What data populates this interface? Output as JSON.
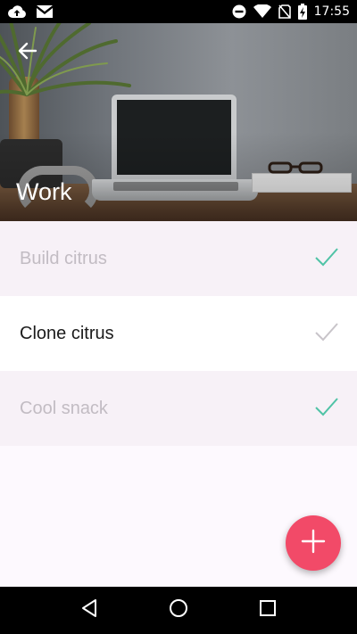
{
  "status_bar": {
    "time": "17:55",
    "icons": [
      "cloud-upload-icon",
      "gmail-icon",
      "do-not-disturb-icon",
      "wifi-icon",
      "no-sim-icon",
      "battery-charging-icon"
    ]
  },
  "header": {
    "title": "Work",
    "back_icon": "arrow-left-icon"
  },
  "tasks": [
    {
      "label": "Build citrus",
      "done": true
    },
    {
      "label": "Clone citrus",
      "done": false
    },
    {
      "label": "Cool snack",
      "done": true
    }
  ],
  "fab": {
    "icon": "plus-icon"
  },
  "nav": [
    "back-icon",
    "home-icon",
    "recents-icon"
  ],
  "colors": {
    "accent": "#f24a68",
    "check_done": "#4fc3a6",
    "check_open": "#c8c4c9",
    "done_text": "#c2bcc3",
    "open_text": "#1b1b1b"
  }
}
